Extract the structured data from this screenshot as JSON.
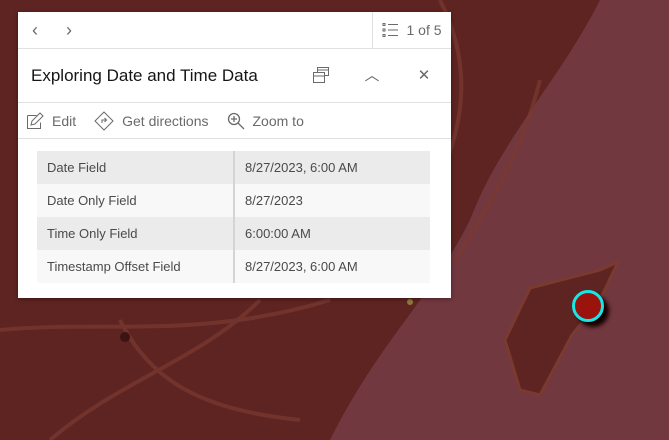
{
  "pager": {
    "text": "1 of 5"
  },
  "popup": {
    "title": "Exploring Date and Time Data"
  },
  "actions": [
    {
      "label": "Edit"
    },
    {
      "label": "Get directions"
    },
    {
      "label": "Zoom to"
    }
  ],
  "fields": [
    {
      "name": "Date Field",
      "value": "8/27/2023, 6:00 AM"
    },
    {
      "name": "Date Only Field",
      "value": "8/27/2023"
    },
    {
      "name": "Time Only Field",
      "value": "6:00:00 AM"
    },
    {
      "name": "Timestamp Offset Field",
      "value": "8/27/2023, 6:00 AM"
    }
  ],
  "colors": {
    "land": "#5e2422",
    "water": "#72383f",
    "marker": "#9b130d",
    "marker_outline": "#19e6e6"
  }
}
